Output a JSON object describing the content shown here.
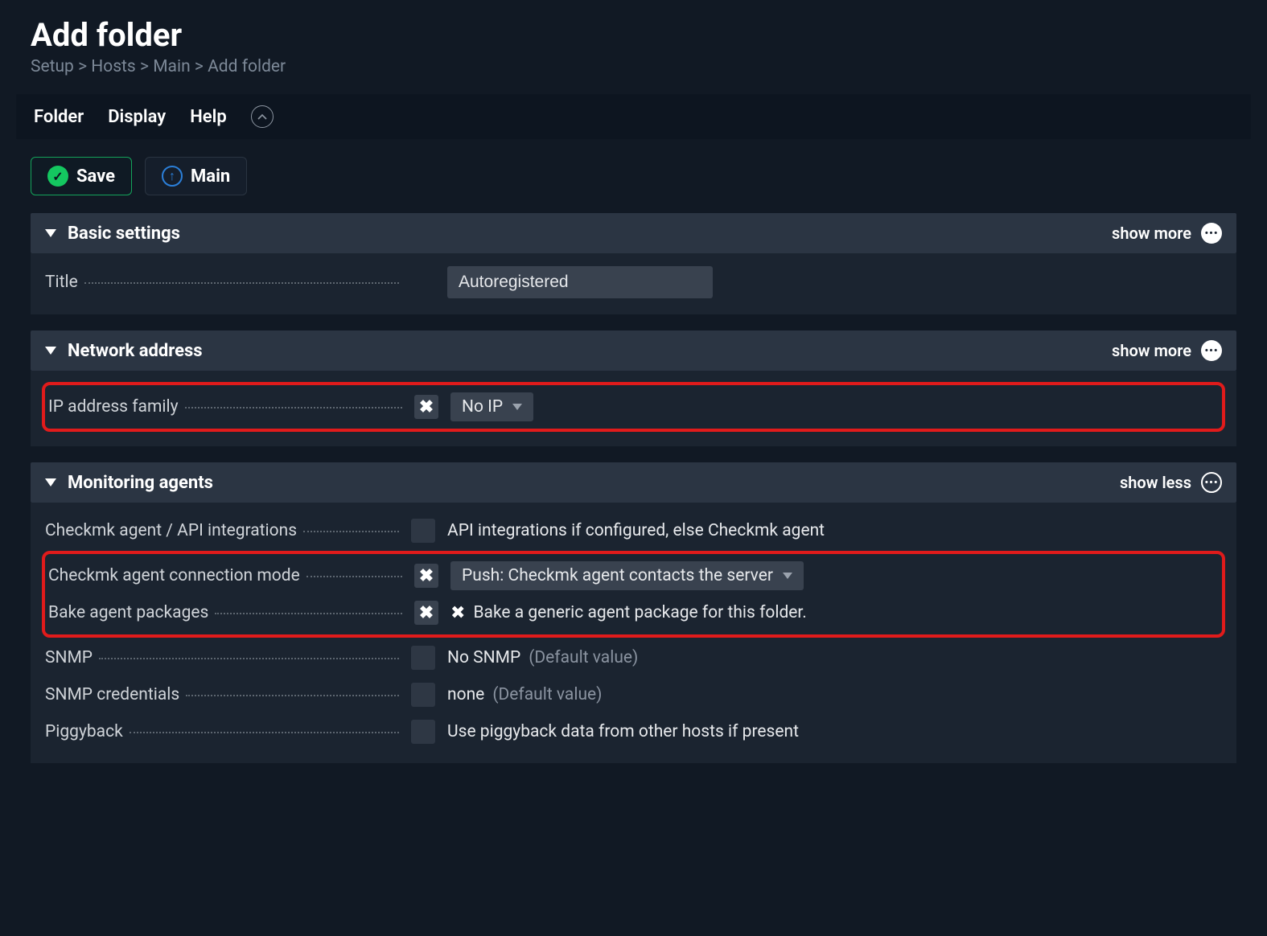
{
  "title": "Add folder",
  "breadcrumb": [
    "Setup",
    "Hosts",
    "Main",
    "Add folder"
  ],
  "menubar": {
    "folder": "Folder",
    "display": "Display",
    "help": "Help"
  },
  "actions": {
    "save": "Save",
    "main": "Main"
  },
  "sections": {
    "basic": {
      "title": "Basic settings",
      "toggle": "show more",
      "rows": {
        "title_label": "Title",
        "title_value": "Autoregistered"
      }
    },
    "network": {
      "title": "Network address",
      "toggle": "show more",
      "rows": {
        "ip_family_label": "IP address family",
        "ip_family_value": "No IP"
      }
    },
    "agents": {
      "title": "Monitoring agents",
      "toggle": "show less",
      "rows": {
        "api_label": "Checkmk agent / API integrations",
        "api_value": "API integrations if configured, else Checkmk agent",
        "conn_label": "Checkmk agent connection mode",
        "conn_value": "Push: Checkmk agent contacts the server",
        "bake_label": "Bake agent packages",
        "bake_value": "Bake a generic agent package for this folder.",
        "snmp_label": "SNMP",
        "snmp_value": "No SNMP",
        "snmp_default": "(Default value)",
        "snmpcred_label": "SNMP credentials",
        "snmpcred_value": "none",
        "snmpcred_default": "(Default value)",
        "piggy_label": "Piggyback",
        "piggy_value": "Use piggyback data from other hosts if present"
      }
    }
  }
}
